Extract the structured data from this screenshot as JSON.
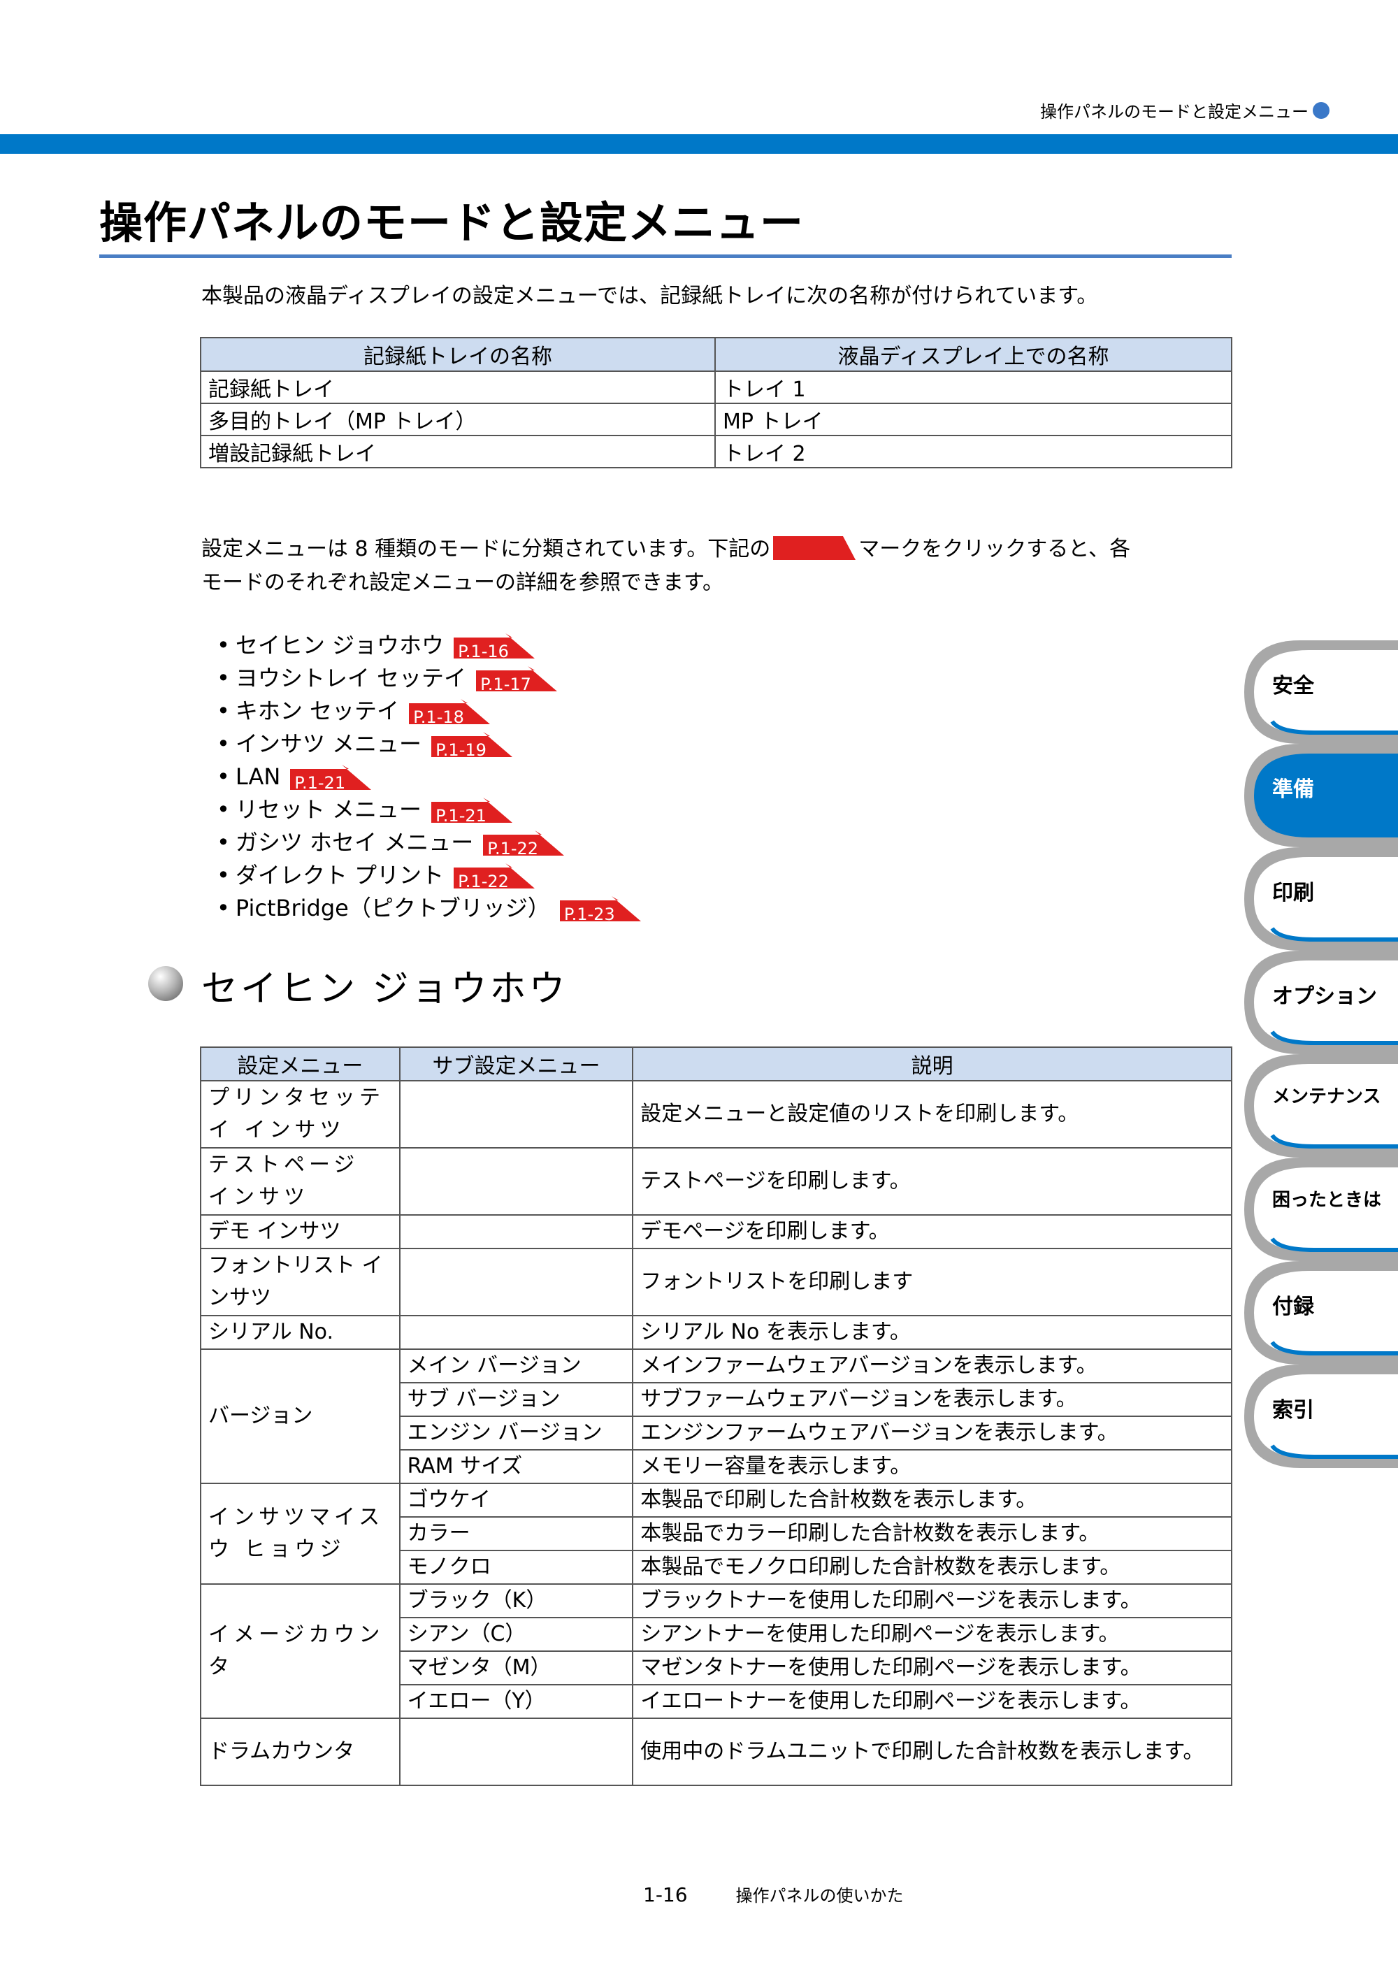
{
  "header": {
    "running_title": "操作パネルのモードと設定メニュー"
  },
  "page_title": "操作パネルのモードと設定メニュー",
  "intro": "本製品の液晶ディスプレイの設定メニューでは、記録紙トレイに次の名称が付けられています。",
  "tray_table": {
    "headers": [
      "記録紙トレイの名称",
      "液晶ディスプレイ上での名称"
    ],
    "rows": [
      [
        "記録紙トレイ",
        "トレイ 1"
      ],
      [
        "多目的トレイ（MP トレイ）",
        "MP トレイ"
      ],
      [
        "増設記録紙トレイ",
        "トレイ 2"
      ]
    ]
  },
  "para": {
    "before": "設定メニューは 8 種類のモードに分類されています。下記の",
    "after": "マークをクリックすると、各",
    "line2": "モードのそれぞれ設定メニューの詳細を参照できます。"
  },
  "modes": [
    {
      "bullet": "•",
      "label": "セイヒン ジョウホウ",
      "ref": "P.1-16"
    },
    {
      "bullet": "•",
      "label": "ヨウシトレイ セッテイ",
      "ref": "P.1-17"
    },
    {
      "bullet": "•",
      "label": "キホン セッテイ",
      "ref": "P.1-18"
    },
    {
      "bullet": "•",
      "label": "インサツ メニュー",
      "ref": "P.1-19"
    },
    {
      "bullet": "•",
      "label": "LAN",
      "ref": "P.1-21"
    },
    {
      "bullet": "•",
      "label": "リセット メニュー",
      "ref": "P.1-21"
    },
    {
      "bullet": "•",
      "label": "ガシツ ホセイ メニュー",
      "ref": "P.1-22"
    },
    {
      "bullet": "•",
      "label": "ダイレクト プリント",
      "ref": "P.1-22"
    },
    {
      "bullet": "•",
      "label": "PictBridge（ピクトブリッジ）",
      "ref": "P.1-23"
    }
  ],
  "section_title": "セイヒン ジョウホウ",
  "spec_table": {
    "headers": [
      "設定メニュー",
      "サブ設定メニュー",
      "説明"
    ],
    "printer_settings": {
      "menu": "プリンタセッテイ インサツ",
      "desc": "設定メニューと設定値のリストを印刷します。"
    },
    "test_page": {
      "menu": "テストページ インサツ",
      "desc": "テストページを印刷します。"
    },
    "demo": {
      "menu": "デモ インサツ",
      "desc": "デモページを印刷します。"
    },
    "font_list": {
      "menu": "フォントリスト インサツ",
      "desc": "フォントリストを印刷します"
    },
    "serial": {
      "menu": "シリアル No.",
      "desc": "シリアル No を表示します。"
    },
    "version": {
      "menu": "バージョン",
      "rows": [
        {
          "sub": "メイン バージョン",
          "desc": "メインファームウェアバージョンを表示します。"
        },
        {
          "sub": "サブ バージョン",
          "desc": "サブファームウェアバージョンを表示します。"
        },
        {
          "sub": "エンジン バージョン",
          "desc": "エンジンファームウェアバージョンを表示します。"
        },
        {
          "sub": "RAM サイズ",
          "desc": "メモリー容量を表示します。"
        }
      ]
    },
    "print_count": {
      "menu": "インサツマイスウ ヒョウジ",
      "rows": [
        {
          "sub": "ゴウケイ",
          "desc": "本製品で印刷した合計枚数を表示します。"
        },
        {
          "sub": "カラー",
          "desc": "本製品でカラー印刷した合計枚数を表示します。"
        },
        {
          "sub": "モノクロ",
          "desc": "本製品でモノクロ印刷した合計枚数を表示します。"
        }
      ]
    },
    "image_count": {
      "menu": "イメージカウンタ",
      "rows": [
        {
          "sub": "ブラック（K）",
          "desc": "ブラックトナーを使用した印刷ページを表示します。"
        },
        {
          "sub": "シアン（C）",
          "desc": "シアントナーを使用した印刷ページを表示します。"
        },
        {
          "sub": "マゼンタ（M）",
          "desc": "マゼンタトナーを使用した印刷ページを表示します。"
        },
        {
          "sub": "イエロー（Y）",
          "desc": "イエロートナーを使用した印刷ページを表示します。"
        }
      ]
    },
    "drum": {
      "menu": "ドラムカウンタ",
      "desc": "使用中のドラムユニットで印刷した合計枚数を表示します。"
    }
  },
  "side_tabs": [
    {
      "label": "安全",
      "active": false
    },
    {
      "label": "準備",
      "active": true
    },
    {
      "label": "印刷",
      "active": false
    },
    {
      "label": "オプション",
      "active": false
    },
    {
      "label": "メンテナンス",
      "active": false
    },
    {
      "label": "困ったときは",
      "active": false
    },
    {
      "label": "付録",
      "active": false
    },
    {
      "label": "索引",
      "active": false
    }
  ],
  "footer": {
    "page_number": "1-16",
    "chapter": "操作パネルの使いかた"
  },
  "colors": {
    "accent_blue": "#0078c8",
    "table_header": "#cddcf0",
    "ref_red": "#e02020",
    "tab_active": "#0078c8",
    "tab_inactive": "#a8a8a8"
  }
}
